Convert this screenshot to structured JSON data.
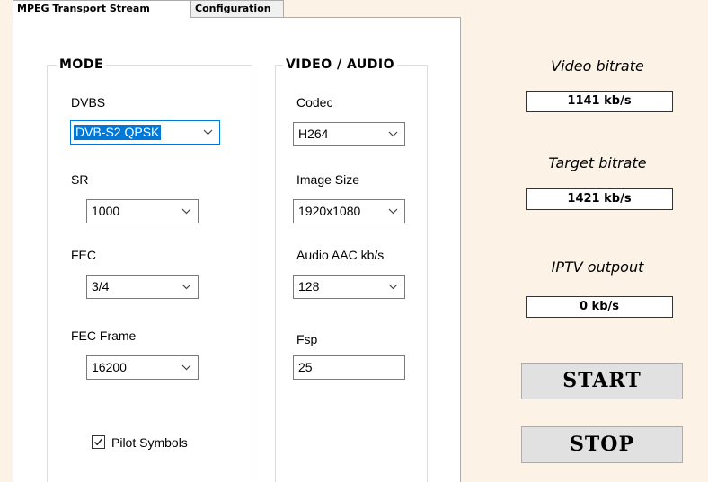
{
  "tabs": [
    {
      "label": "MPEG Transport Stream",
      "active": true
    },
    {
      "label": "Configuration",
      "active": false
    }
  ],
  "mode_group": {
    "title": "MODE",
    "dvbs": {
      "label": "DVBS",
      "value": "DVB-S2 QPSK"
    },
    "sr": {
      "label": "SR",
      "value": "1000"
    },
    "fec": {
      "label": "FEC",
      "value": "3/4"
    },
    "fec_frame": {
      "label": "FEC Frame",
      "value": "16200"
    },
    "pilot_symbols": {
      "label": "Pilot Symbols",
      "checked": true
    }
  },
  "video_audio_group": {
    "title": "VIDEO / AUDIO",
    "codec": {
      "label": "Codec",
      "value": "H264"
    },
    "image_size": {
      "label": "Image Size",
      "value": "1920x1080"
    },
    "audio_aac": {
      "label": "Audio AAC  kb/s",
      "value": "128"
    },
    "fsp": {
      "label": "Fsp",
      "value": "25"
    }
  },
  "stats": {
    "video_bitrate": {
      "title": "Video bitrate",
      "value": "1141 kb/s"
    },
    "target_bitrate": {
      "title": "Target bitrate",
      "value": "1421 kb/s"
    },
    "iptv_output": {
      "title": "IPTV outpout",
      "value": "0 kb/s"
    }
  },
  "buttons": {
    "start": "START",
    "stop": "STOP"
  },
  "icons": {
    "dropdown": "chevron-down-icon",
    "check": "checkmark-icon"
  },
  "colors": {
    "background": "#FCF3E6",
    "selection": "#0078D7",
    "button": "#E1E1E1"
  }
}
